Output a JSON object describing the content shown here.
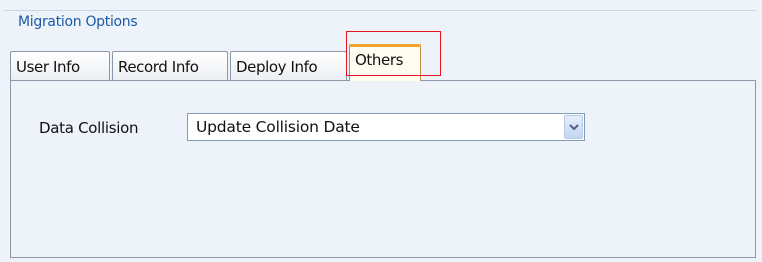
{
  "group": {
    "title": "Migration Options"
  },
  "tabs": [
    {
      "label": "User Info",
      "active": false
    },
    {
      "label": "Record Info",
      "active": false
    },
    {
      "label": "Deploy Info",
      "active": false
    },
    {
      "label": "Others",
      "active": true
    }
  ],
  "panel": {
    "data_collision": {
      "label": "Data Collision",
      "value": "Update Collision Date",
      "icon": "chevron-down-icon"
    }
  },
  "colors": {
    "accent_title": "#1c5aa6",
    "active_tab_top": "#f1a52c",
    "highlight_box": "#e8141f",
    "background": "#eef3fa"
  }
}
